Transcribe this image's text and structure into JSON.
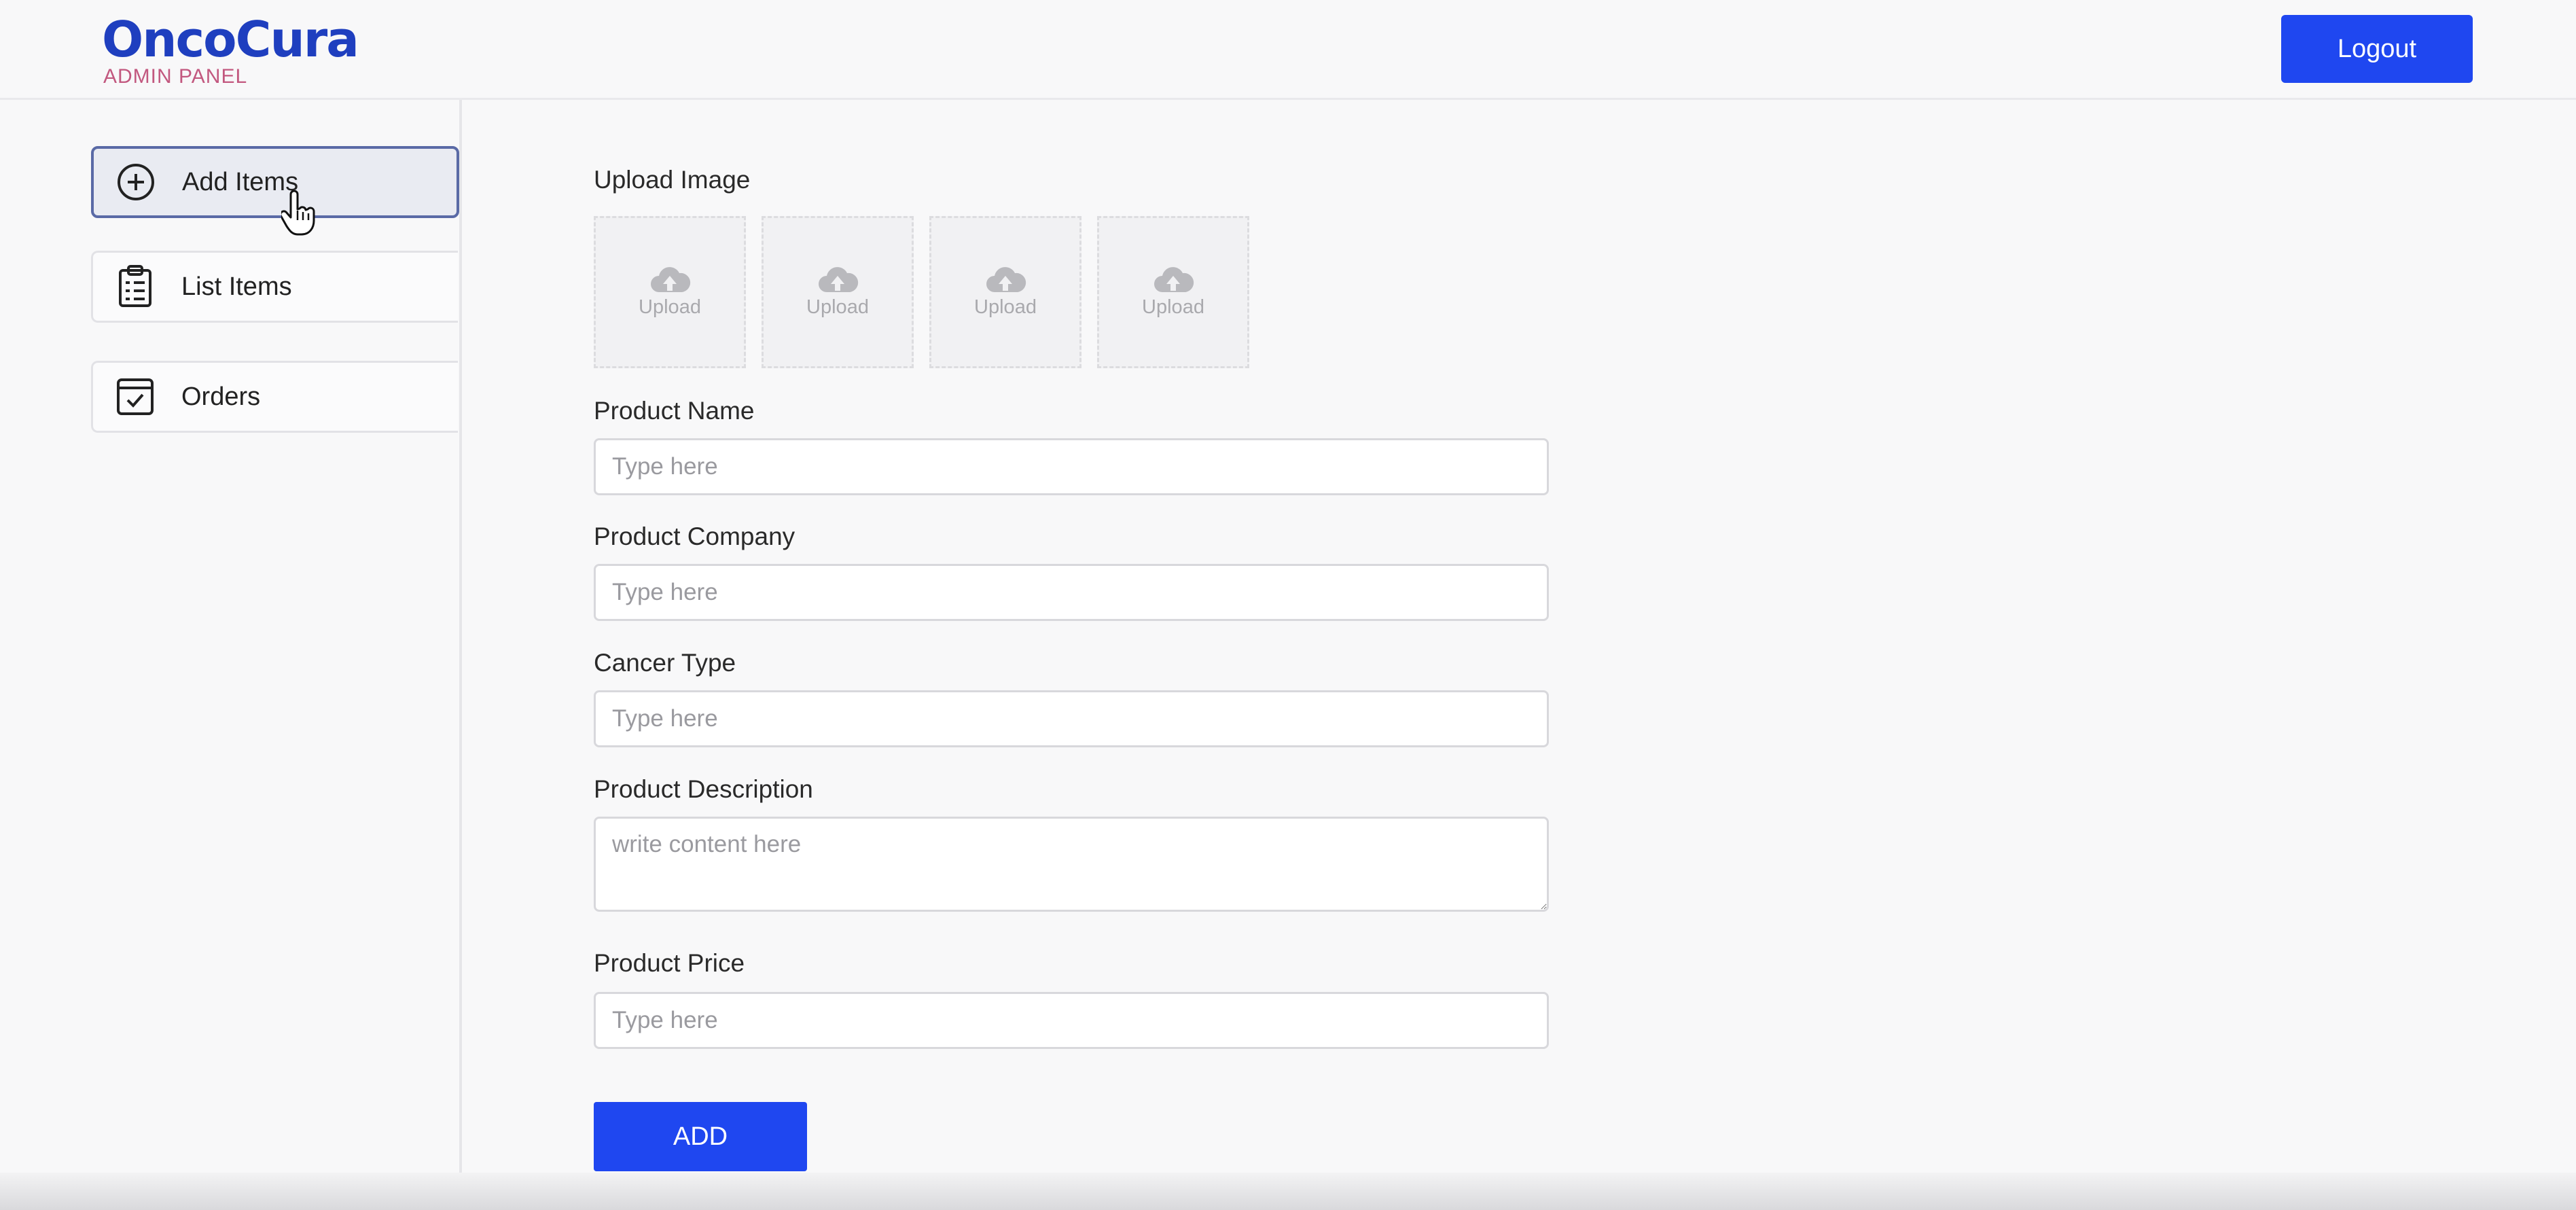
{
  "app": {
    "logo_part1": "Onco",
    "logo_part2": "Cura",
    "logo_subtitle": "ADMIN PANEL",
    "brand_color": "#1f3fbf",
    "accent_color": "#1f47f0"
  },
  "header": {
    "logout_label": "Logout"
  },
  "sidebar": {
    "items": [
      {
        "label": "Add Items",
        "icon": "plus-circle-icon",
        "active": true
      },
      {
        "label": "List Items",
        "icon": "clipboard-list-icon",
        "active": false
      },
      {
        "label": "Orders",
        "icon": "checkbox-icon",
        "active": false
      }
    ]
  },
  "form": {
    "upload_label": "Upload Image",
    "upload_text": "Upload",
    "product_name_label": "Product Name",
    "product_name_placeholder": "Type here",
    "product_company_label": "Product Company",
    "product_company_placeholder": "Type here",
    "cancer_type_label": "Cancer Type",
    "cancer_type_placeholder": "Type here",
    "description_label": "Product Description",
    "description_placeholder": "write content here",
    "price_label": "Product Price",
    "price_placeholder": "Type here",
    "submit_label": "ADD"
  }
}
